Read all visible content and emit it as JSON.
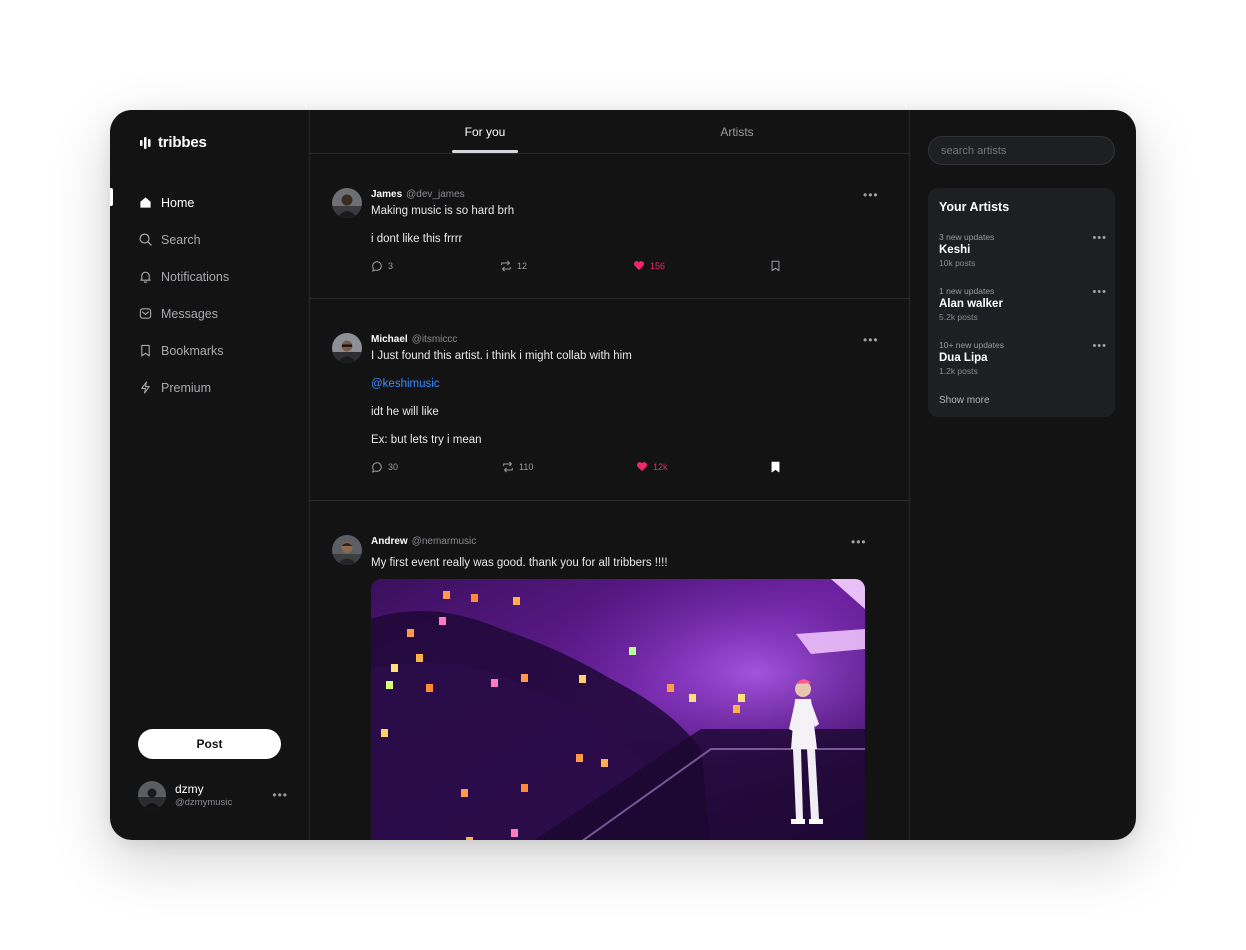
{
  "app": {
    "name": "tribbes"
  },
  "nav": {
    "items": [
      {
        "label": "Home",
        "icon": "home-icon",
        "active": true
      },
      {
        "label": "Search",
        "icon": "search-icon"
      },
      {
        "label": "Notifications",
        "icon": "bell-icon"
      },
      {
        "label": "Messages",
        "icon": "message-icon"
      },
      {
        "label": "Bookmarks",
        "icon": "bookmark-icon"
      },
      {
        "label": "Premium",
        "icon": "lightning-icon"
      }
    ],
    "post_label": "Post"
  },
  "profile": {
    "name": "dzmy",
    "handle": "@dzmymusic"
  },
  "tabs": [
    {
      "label": "For you",
      "active": true
    },
    {
      "label": "Artists"
    }
  ],
  "posts": [
    {
      "author": "James",
      "handle": "@dev_james",
      "lines": [
        "Making music is so hard brh",
        "i dont like this frrrr"
      ],
      "replies": "3",
      "reposts": "12",
      "likes": "156",
      "bookmarked": false
    },
    {
      "author": "Michael",
      "handle": "@itsmiccc",
      "lines": [
        "I Just found this artist. i think i might collab with him",
        "@keshimusic",
        "idt he will like",
        "Ex: but lets try i mean"
      ],
      "replies": "30",
      "reposts": "110",
      "likes": "12k",
      "bookmarked": true
    },
    {
      "author": "Andrew",
      "handle": "@nemarmusic",
      "lines": [
        "My first event really was good. thank you for all tribbers !!!!"
      ]
    }
  ],
  "search": {
    "placeholder": "search artists"
  },
  "your_artists": {
    "title": "Your Artists",
    "items": [
      {
        "updates": "3 new updates",
        "name": "Keshi",
        "posts": "10k posts"
      },
      {
        "updates": "1 new updates",
        "name": "Alan walker",
        "posts": "5.2k posts"
      },
      {
        "updates": "10+ new updates",
        "name": "Dua Lipa",
        "posts": "1.2k posts"
      }
    ],
    "show_more": "Show more"
  },
  "colors": {
    "background": "#131314",
    "card": "#1e1f22",
    "like": "#f0266b",
    "mention": "#3d8bff"
  }
}
